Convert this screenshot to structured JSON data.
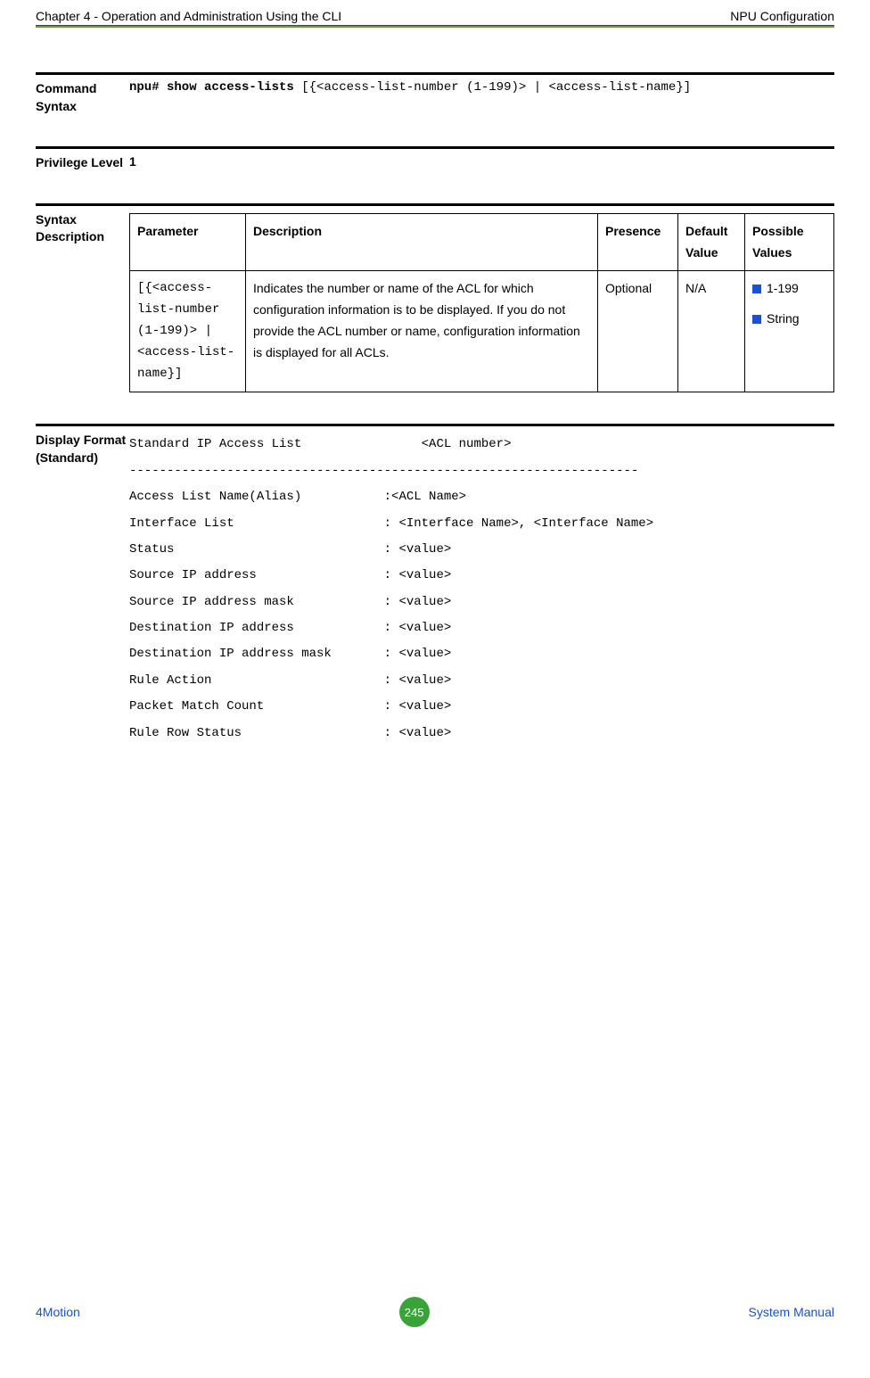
{
  "header": {
    "left": "Chapter 4 - Operation and Administration Using the CLI",
    "right": "NPU Configuration"
  },
  "cmd_syntax": {
    "label": "Command Syntax",
    "prompt": "npu# show access-lists",
    "rest": " [{<access-list-number (1-199)> | <access-list-name}]"
  },
  "priv": {
    "label": "Privilege Level",
    "value": "1"
  },
  "syntax_desc": {
    "label": "Syntax Description",
    "headers": {
      "param": "Parameter",
      "desc": "Description",
      "pres": "Presence",
      "def": "Default Value",
      "poss": "Possible Values"
    },
    "row": {
      "param": "[{<access-list-number (1-199)> | <access-list-name}]",
      "desc": "Indicates the number or name of the ACL for which configuration information is to be displayed. If you do not provide the ACL number or name, configuration information is displayed for all ACLs.",
      "pres": "Optional",
      "def": "N/A",
      "poss1": "1-199",
      "poss2": "String"
    }
  },
  "display": {
    "label": "Display Format (Standard)",
    "lines": {
      "l0": "Standard IP Access List                <ACL number>",
      "sep": "--------------------------------------------------------------------",
      "l1": "Access List Name(Alias)           :<ACL Name>",
      "l2": "Interface List                    : <Interface Name>, <Interface Name>",
      "l3": "Status                            : <value>",
      "l4": "Source IP address                 : <value>",
      "l5": "Source IP address mask            : <value>",
      "l6": "Destination IP address            : <value>",
      "l7": "Destination IP address mask       : <value>",
      "l8": "Rule Action                       : <value>",
      "l9": "Packet Match Count                : <value>",
      "l10": "Rule Row Status                   : <value>"
    }
  },
  "footer": {
    "left": "4Motion",
    "page": "245",
    "right": "System Manual"
  }
}
